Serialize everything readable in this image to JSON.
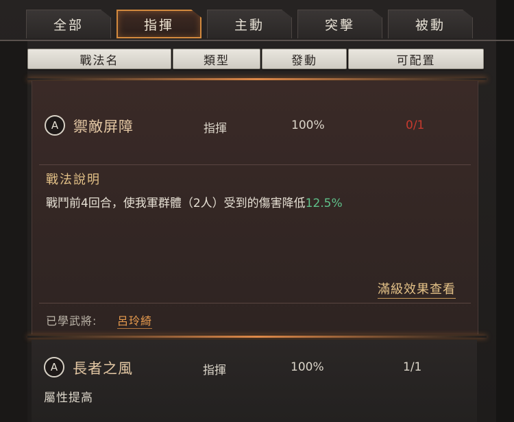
{
  "tabs": [
    {
      "label": "全部",
      "active": false
    },
    {
      "label": "指揮",
      "active": true
    },
    {
      "label": "主動",
      "active": false
    },
    {
      "label": "突擊",
      "active": false
    },
    {
      "label": "被動",
      "active": false
    }
  ],
  "columns": {
    "name": "戰法名",
    "type": "類型",
    "trigger": "發動",
    "configurable": "可配置"
  },
  "skills": [
    {
      "grade": "A",
      "name": "禦敵屏障",
      "type": "指揮",
      "rate": "100%",
      "config": "0/1",
      "description_title": "戰法說明",
      "description_prefix": "戰鬥前4回合，使我軍群體（2人）受到的傷害降低",
      "description_highlight": "12.5%",
      "max_level_link": "滿級效果查看",
      "learned_label": "已學武將:",
      "learned_general": "呂玲綺"
    },
    {
      "grade": "A",
      "name": "長者之風",
      "type": "指揮",
      "rate": "100%",
      "config": "1/1",
      "subtitle": "屬性提高"
    }
  ],
  "colors": {
    "accent": "#e08a4a",
    "config_full": "#c63a2e",
    "highlight": "#5fc18a",
    "gold_text": "#e3c187"
  }
}
